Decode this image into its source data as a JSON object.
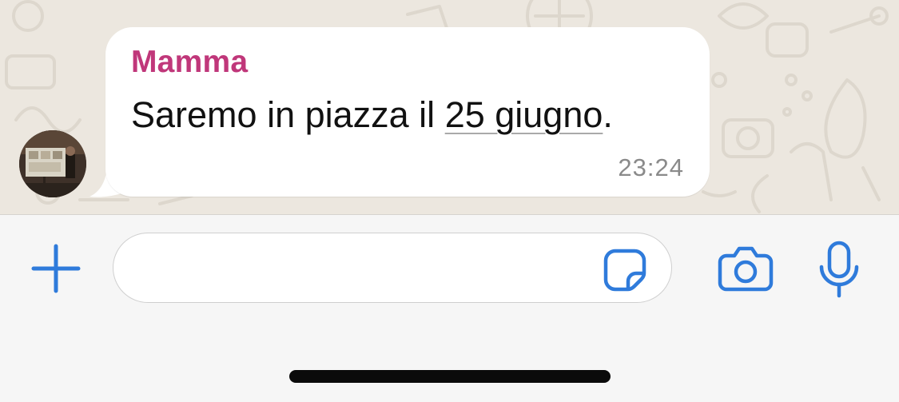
{
  "chat": {
    "message": {
      "sender": "Mamma",
      "text_before": "Saremo in piazza il ",
      "link_text": "25 giugno",
      "text_after": ".",
      "time": "23:24"
    }
  },
  "composer": {
    "placeholder": "",
    "value": ""
  },
  "icons": {
    "add": "plus-icon",
    "sticker": "sticker-icon",
    "camera": "camera-icon",
    "mic": "microphone-icon"
  },
  "colors": {
    "accent": "#2f7bdb",
    "sender": "#c0377a",
    "wallpaper": "#ece7df"
  }
}
